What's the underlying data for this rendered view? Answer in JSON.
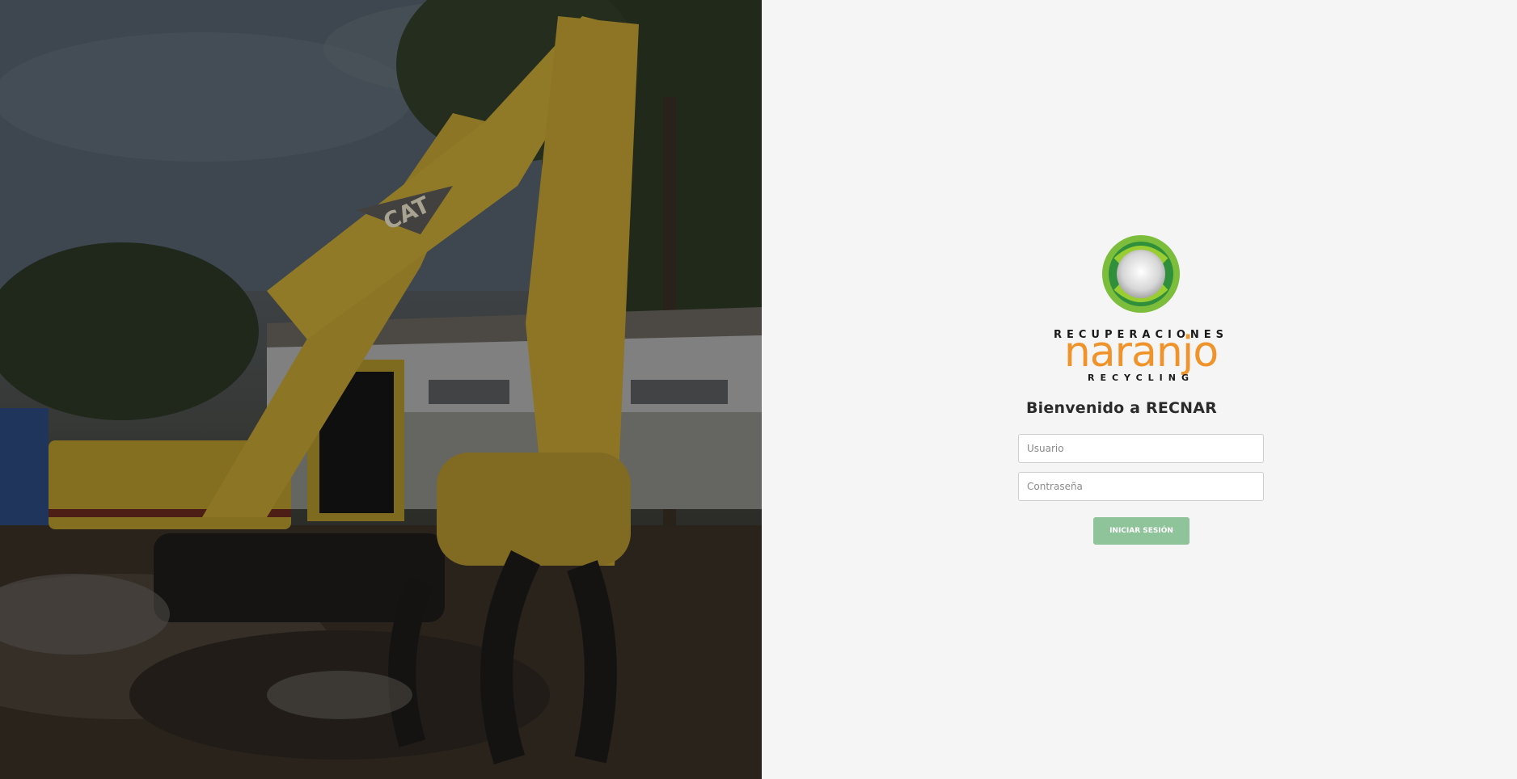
{
  "hero": {
    "alt": "Excavadora CAT en patio de reciclaje",
    "machine_brand": "CAT"
  },
  "logo": {
    "line1": "RECUPERACIONES",
    "line2": "naranjo",
    "line3": "RECYCLING"
  },
  "login": {
    "welcome": "Bienvenido a RECNAR",
    "username_placeholder": "Usuario",
    "password_placeholder": "Contraseña",
    "submit_label": "INICIAR SESIÓN"
  },
  "colors": {
    "brand_orange": "#f0932b",
    "brand_green": "#6ab04c",
    "button_green": "#8fc39a"
  }
}
